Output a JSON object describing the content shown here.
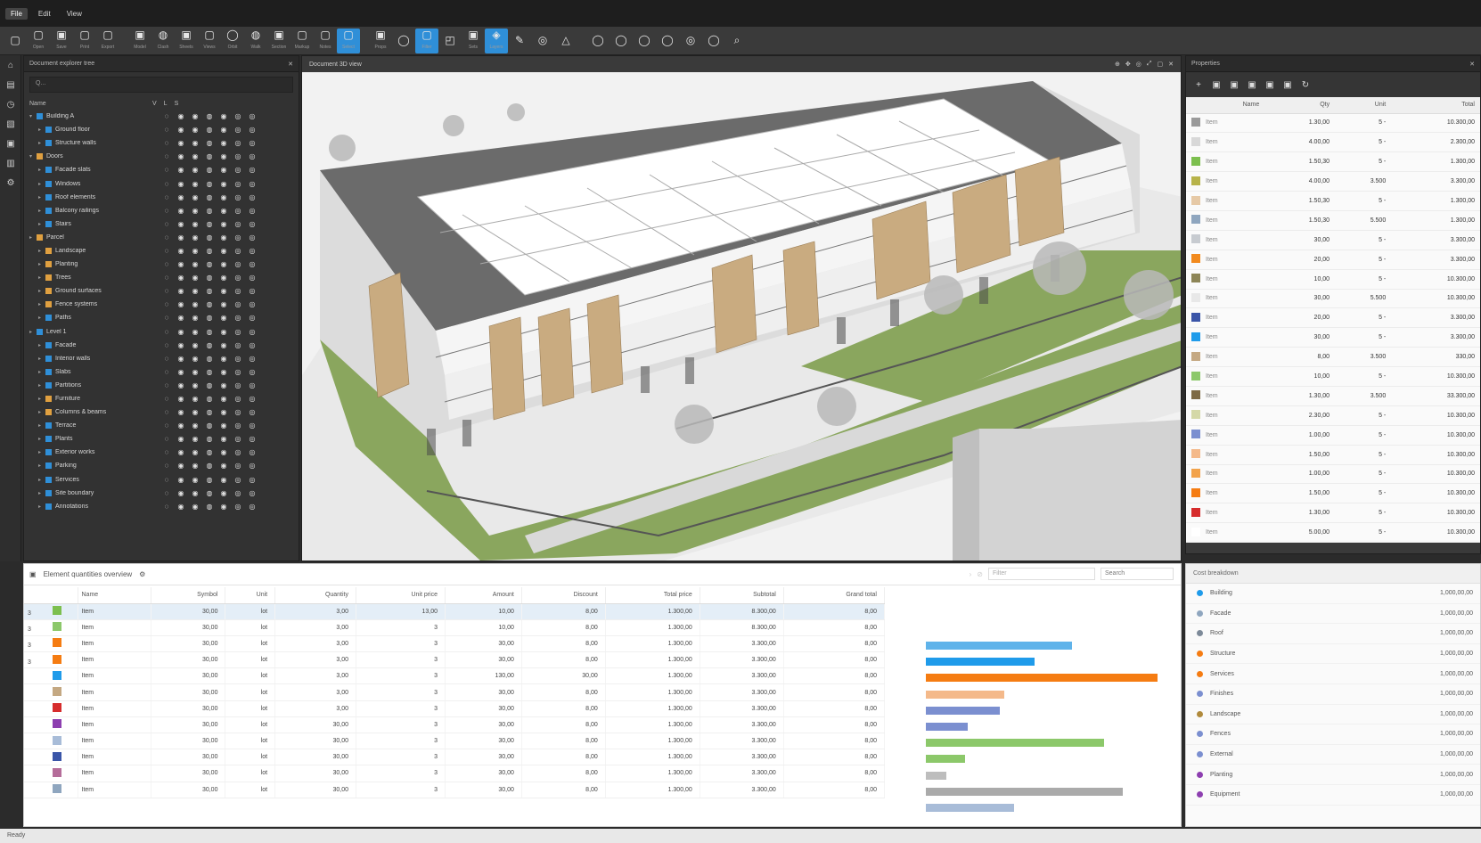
{
  "menubar": {
    "items": [
      "File",
      "Edit",
      "View"
    ]
  },
  "toolbar": {
    "tools": [
      {
        "icon": "square-icon",
        "glyph": "▢",
        "label": ""
      },
      {
        "icon": "square-icon",
        "glyph": "▢",
        "label": "Open"
      },
      {
        "icon": "square-icon",
        "glyph": "▣",
        "label": "Save"
      },
      {
        "icon": "square-icon",
        "glyph": "▢",
        "label": "Print"
      },
      {
        "icon": "square-icon",
        "glyph": "▢",
        "label": "Export"
      },
      {
        "sep": true
      },
      {
        "icon": "square-icon",
        "glyph": "▣",
        "label": "Model"
      },
      {
        "icon": "square-icon",
        "glyph": "◍",
        "label": "Clash"
      },
      {
        "icon": "square-icon",
        "glyph": "▣",
        "label": "Sheets"
      },
      {
        "icon": "square-icon",
        "glyph": "▢",
        "label": "Views"
      },
      {
        "icon": "circle-icon",
        "glyph": "◯",
        "label": "Orbit"
      },
      {
        "icon": "circle-icon",
        "glyph": "◍",
        "label": "Walk"
      },
      {
        "icon": "square-icon",
        "glyph": "▣",
        "label": "Section"
      },
      {
        "icon": "square-icon",
        "glyph": "▢",
        "label": "Markup"
      },
      {
        "icon": "square-icon",
        "glyph": "▢",
        "label": "Notes"
      },
      {
        "icon": "square-icon",
        "glyph": "▢",
        "label": "Select",
        "active": true
      },
      {
        "sep": true
      },
      {
        "icon": "square-icon",
        "glyph": "▣",
        "label": "Props"
      },
      {
        "icon": "circle-icon",
        "glyph": "◯",
        "label": ""
      },
      {
        "icon": "square-icon",
        "glyph": "▢",
        "label": "Filter",
        "active": true
      },
      {
        "icon": "square-icon",
        "glyph": "◰",
        "label": ""
      },
      {
        "icon": "square-icon",
        "glyph": "▣",
        "label": "Sets"
      },
      {
        "icon": "square-icon",
        "glyph": "◈",
        "label": "Layers",
        "active": true
      },
      {
        "icon": "pencil-icon",
        "glyph": "✎",
        "label": ""
      },
      {
        "icon": "circle-icon",
        "glyph": "◎",
        "label": ""
      },
      {
        "icon": "triangle-icon",
        "glyph": "△",
        "label": ""
      },
      {
        "sep": true
      },
      {
        "icon": "circle-icon",
        "glyph": "◯",
        "label": ""
      },
      {
        "icon": "circle-icon",
        "glyph": "◯",
        "label": ""
      },
      {
        "icon": "circle-icon",
        "glyph": "◯",
        "label": ""
      },
      {
        "icon": "circle-icon",
        "glyph": "◯",
        "label": ""
      },
      {
        "icon": "circle-icon",
        "glyph": "◎",
        "label": ""
      },
      {
        "icon": "circle-icon",
        "glyph": "◯",
        "label": ""
      },
      {
        "icon": "search-icon",
        "glyph": "⌕",
        "label": ""
      }
    ]
  },
  "rail": {
    "icons": [
      "home-icon",
      "layers-icon",
      "clock-icon",
      "image-icon",
      "lock-icon",
      "chart-icon",
      "gear-icon"
    ]
  },
  "tree": {
    "title": "Document explorer tree",
    "search_placeholder": "Q...",
    "columns": [
      "Name",
      "V",
      "L",
      "S"
    ],
    "rows": [
      {
        "name": "Building A",
        "color": "#2f8fd8",
        "depth": 0,
        "open": true
      },
      {
        "name": "Ground floor",
        "color": "#2f8fd8",
        "depth": 1
      },
      {
        "name": "Structure walls",
        "color": "#2f8fd8",
        "depth": 1
      },
      {
        "name": "Doors",
        "color": "#e0a040",
        "depth": 0,
        "open": true
      },
      {
        "name": "Facade slats",
        "color": "#2f8fd8",
        "depth": 1
      },
      {
        "name": "Windows",
        "color": "#2f8fd8",
        "depth": 1
      },
      {
        "name": "Roof elements",
        "color": "#2f8fd8",
        "depth": 1
      },
      {
        "name": "Balcony railings",
        "color": "#2f8fd8",
        "depth": 1
      },
      {
        "name": "Stairs",
        "color": "#2f8fd8",
        "depth": 1
      },
      {
        "name": "Parcel",
        "color": "#e0a040",
        "depth": 0
      },
      {
        "name": "Landscape",
        "color": "#e0a040",
        "depth": 1
      },
      {
        "name": "Planting",
        "color": "#e0a040",
        "depth": 1
      },
      {
        "name": "Trees",
        "color": "#e0a040",
        "depth": 1
      },
      {
        "name": "Ground surfaces",
        "color": "#e0a040",
        "depth": 1
      },
      {
        "name": "Fence systems",
        "color": "#e0a040",
        "depth": 1
      },
      {
        "name": "Paths",
        "color": "#2f8fd8",
        "depth": 1
      },
      {
        "name": "Level 1",
        "color": "#2f8fd8",
        "depth": 0
      },
      {
        "name": "Facade",
        "color": "#2f8fd8",
        "depth": 1
      },
      {
        "name": "Interior walls",
        "color": "#2f8fd8",
        "depth": 1
      },
      {
        "name": "Slabs",
        "color": "#2f8fd8",
        "depth": 1
      },
      {
        "name": "Partitions",
        "color": "#2f8fd8",
        "depth": 1
      },
      {
        "name": "Furniture",
        "color": "#e0a040",
        "depth": 1
      },
      {
        "name": "Columns & beams",
        "color": "#e0a040",
        "depth": 1
      },
      {
        "name": "Terrace",
        "color": "#2f8fd8",
        "depth": 1
      },
      {
        "name": "Plants",
        "color": "#2f8fd8",
        "depth": 1
      },
      {
        "name": "Exterior works",
        "color": "#2f8fd8",
        "depth": 1
      },
      {
        "name": "Parking",
        "color": "#2f8fd8",
        "depth": 1
      },
      {
        "name": "Services",
        "color": "#2f8fd8",
        "depth": 1
      },
      {
        "name": "Site boundary",
        "color": "#2f8fd8",
        "depth": 1
      },
      {
        "name": "Annotations",
        "color": "#2f8fd8",
        "depth": 1
      }
    ]
  },
  "viewport": {
    "title": "Document 3D view"
  },
  "rightTop": {
    "title": "Properties",
    "columns": [
      "",
      "Name",
      "Qty",
      "Unit",
      "Total"
    ],
    "rows": [
      {
        "color": "#9a9a9a",
        "name": "Item",
        "qty": "1.30,00",
        "unit": "5 -",
        "total": "10.300,00"
      },
      {
        "color": "#d8d8d8",
        "name": "Item",
        "qty": "4.00,00",
        "unit": "5 -",
        "total": "2.300,00"
      },
      {
        "color": "#7cbf4e",
        "name": "Item",
        "qty": "1.50,30",
        "unit": "5 -",
        "total": "1.300,00"
      },
      {
        "color": "#b7b34a",
        "name": "Item",
        "qty": "4.00,00",
        "unit": "3.500",
        "total": "3.300,00"
      },
      {
        "color": "#e6c9a6",
        "name": "Item",
        "qty": "1.50,30",
        "unit": "5 -",
        "total": "1.300,00"
      },
      {
        "color": "#8fa6bf",
        "name": "Item",
        "qty": "1.50,30",
        "unit": "5.500",
        "total": "1.300,00"
      },
      {
        "color": "#c7cbd0",
        "name": "Item",
        "qty": "30,00",
        "unit": "5 -",
        "total": "3.300,00"
      },
      {
        "color": "#f28a1e",
        "name": "Item",
        "qty": "20,00",
        "unit": "5 -",
        "total": "3.300,00"
      },
      {
        "color": "#8d8557",
        "name": "Item",
        "qty": "10,00",
        "unit": "5 -",
        "total": "10.300,00"
      },
      {
        "color": "#e8e8e8",
        "name": "Item",
        "qty": "30,00",
        "unit": "5.500",
        "total": "10.300,00"
      },
      {
        "color": "#3a55a8",
        "name": "Item",
        "qty": "20,00",
        "unit": "5 -",
        "total": "3.300,00"
      },
      {
        "color": "#1f9bea",
        "name": "Item",
        "qty": "30,00",
        "unit": "5 -",
        "total": "3.300,00"
      },
      {
        "color": "#c4a882",
        "name": "Item",
        "qty": "8,00",
        "unit": "3.500",
        "total": "330,00"
      },
      {
        "color": "#8cc86a",
        "name": "Item",
        "qty": "10,00",
        "unit": "5 -",
        "total": "10.300,00"
      },
      {
        "color": "#7d6a45",
        "name": "Item",
        "qty": "1.30,00",
        "unit": "3.500",
        "total": "33.300,00"
      },
      {
        "color": "#d4d8a8",
        "name": "Item",
        "qty": "2.30,00",
        "unit": "5 -",
        "total": "10.300,00"
      },
      {
        "color": "#7b8fd0",
        "name": "Item",
        "qty": "1.00,00",
        "unit": "5 -",
        "total": "10.300,00"
      },
      {
        "color": "#f4b98a",
        "name": "Item",
        "qty": "1.50,00",
        "unit": "5 -",
        "total": "10.300,00"
      },
      {
        "color": "#f2a24a",
        "name": "Item",
        "qty": "1.00,00",
        "unit": "5 -",
        "total": "10.300,00"
      },
      {
        "color": "#f57c12",
        "name": "Item",
        "qty": "1.50,00",
        "unit": "5 -",
        "total": "10.300,00"
      },
      {
        "color": "#d62c2c",
        "name": "Item",
        "qty": "1.30,00",
        "unit": "5 -",
        "total": "10.300,00"
      },
      {
        "color": "#ffffff",
        "name": "Item",
        "qty": "5.00,00",
        "unit": "5 -",
        "total": "10.300,00"
      }
    ]
  },
  "bottom": {
    "title": "Element quantities overview",
    "filter_placeholder": "Filter",
    "filter_select": "Search",
    "columns": [
      "",
      "Name",
      "Symbol",
      "Unit",
      "Quantity",
      "Unit price",
      "Amount",
      "Discount",
      "Total price",
      "Subtotal",
      "Grand total"
    ],
    "rows": [
      {
        "idx": "3",
        "color": "#7cbf4e",
        "name": "Item",
        "sym": "30,00",
        "unit": "lot",
        "q": "3,00",
        "up": "13,00",
        "a": "10,00",
        "d": "8,00",
        "tp": "1.300,00",
        "st": "8.300,00",
        "gt": "8,00",
        "selected": true
      },
      {
        "idx": "3",
        "color": "#8cc86a",
        "name": "Item",
        "sym": "30,00",
        "unit": "lot",
        "q": "3,00",
        "up": "3",
        "a": "10,00",
        "d": "8,00",
        "tp": "1.300,00",
        "st": "8.300,00",
        "gt": "8,00"
      },
      {
        "idx": "3",
        "color": "#f57c12",
        "name": "Item",
        "sym": "30,00",
        "unit": "lot",
        "q": "3,00",
        "up": "3",
        "a": "30,00",
        "d": "8,00",
        "tp": "1.300,00",
        "st": "3.300,00",
        "gt": "8,00"
      },
      {
        "idx": "3",
        "color": "#f57c12",
        "name": "Item",
        "sym": "30,00",
        "unit": "lot",
        "q": "3,00",
        "up": "3",
        "a": "30,00",
        "d": "8,00",
        "tp": "1.300,00",
        "st": "3.300,00",
        "gt": "8,00"
      },
      {
        "idx": "",
        "color": "#1f9bea",
        "name": "Item",
        "sym": "30,00",
        "unit": "lot",
        "q": "3,00",
        "up": "3",
        "a": "130,00",
        "d": "30,00",
        "tp": "1.300,00",
        "st": "3.300,00",
        "gt": "8,00"
      },
      {
        "idx": "",
        "color": "#c4a882",
        "name": "Item",
        "sym": "30,00",
        "unit": "lot",
        "q": "3,00",
        "up": "3",
        "a": "30,00",
        "d": "8,00",
        "tp": "1.300,00",
        "st": "3.300,00",
        "gt": "8,00"
      },
      {
        "idx": "",
        "color": "#d62c2c",
        "name": "Item",
        "sym": "30,00",
        "unit": "lot",
        "q": "3,00",
        "up": "3",
        "a": "30,00",
        "d": "8,00",
        "tp": "1.300,00",
        "st": "3.300,00",
        "gt": "8,00"
      },
      {
        "idx": "",
        "color": "#8d3fb0",
        "name": "Item",
        "sym": "30,00",
        "unit": "lot",
        "q": "30,00",
        "up": "3",
        "a": "30,00",
        "d": "8,00",
        "tp": "1.300,00",
        "st": "3.300,00",
        "gt": "8,00"
      },
      {
        "idx": "",
        "color": "#a8bcd8",
        "name": "Item",
        "sym": "30,00",
        "unit": "lot",
        "q": "30,00",
        "up": "3",
        "a": "30,00",
        "d": "8,00",
        "tp": "1.300,00",
        "st": "3.300,00",
        "gt": "8,00"
      },
      {
        "idx": "",
        "color": "#3a55a8",
        "name": "Item",
        "sym": "30,00",
        "unit": "lot",
        "q": "30,00",
        "up": "3",
        "a": "30,00",
        "d": "8,00",
        "tp": "1.300,00",
        "st": "3.300,00",
        "gt": "8,00"
      },
      {
        "idx": "",
        "color": "#b56d9a",
        "name": "Item",
        "sym": "30,00",
        "unit": "lot",
        "q": "30,00",
        "up": "3",
        "a": "30,00",
        "d": "8,00",
        "tp": "1.300,00",
        "st": "3.300,00",
        "gt": "8,00"
      },
      {
        "idx": "",
        "color": "#8fa6bf",
        "name": "Item",
        "sym": "30,00",
        "unit": "lot",
        "q": "30,00",
        "up": "3",
        "a": "30,00",
        "d": "8,00",
        "tp": "1.300,00",
        "st": "3.300,00",
        "gt": "8,00"
      }
    ],
    "bars": [
      {
        "color": "#5fb3ea",
        "value": 0.63
      },
      {
        "color": "#1f9bea",
        "value": 0.47
      },
      {
        "color": "#f57c12",
        "value": 1.0
      },
      {
        "color": "#f4b98a",
        "value": 0.34
      },
      {
        "color": "#7b8fd0",
        "value": 0.32
      },
      {
        "color": "#7b8fd0",
        "value": 0.18
      },
      {
        "color": "#8cc86a",
        "value": 0.77
      },
      {
        "color": "#8cc86a",
        "value": 0.17
      },
      {
        "color": "#bdbdbd",
        "value": 0.09
      },
      {
        "color": "#aaaaaa",
        "value": 0.85
      },
      {
        "color": "#a8bcd8",
        "value": 0.38
      }
    ]
  },
  "rightBot": {
    "title": "Cost breakdown",
    "rows": [
      {
        "color": "#1f9bea",
        "label": "Building",
        "value": "1,000,00,00"
      },
      {
        "color": "#8fa6bf",
        "label": "Facade",
        "value": "1,000,00,00"
      },
      {
        "color": "#7d8a99",
        "label": "Roof",
        "value": "1,000,00,00"
      },
      {
        "color": "#f57c12",
        "label": "Structure",
        "value": "1,000,00,00"
      },
      {
        "color": "#f57c12",
        "label": "Services",
        "value": "1,000,00,00"
      },
      {
        "color": "#7b8fd0",
        "label": "Finishes",
        "value": "1,000,00,00"
      },
      {
        "color": "#b08a3c",
        "label": "Landscape",
        "value": "1,000,00,00"
      },
      {
        "color": "#7b8fd0",
        "label": "Fences",
        "value": "1,000,00,00"
      },
      {
        "color": "#7b8fd0",
        "label": "External",
        "value": "1,000,00,00"
      },
      {
        "color": "#8d3fb0",
        "label": "Planting",
        "value": "1,000,00,00"
      },
      {
        "color": "#8d3fb0",
        "label": "Equipment",
        "value": "1,000,00,00"
      }
    ]
  },
  "status": {
    "text": "Ready"
  }
}
